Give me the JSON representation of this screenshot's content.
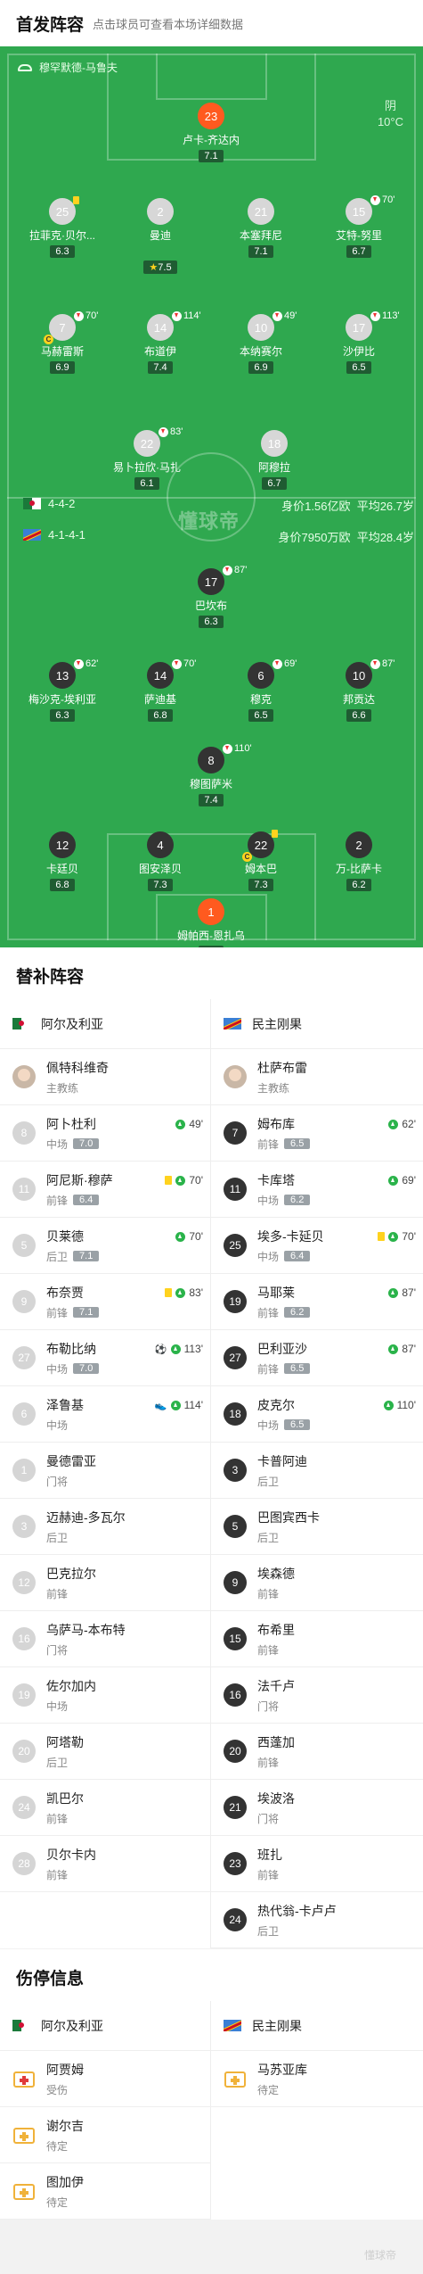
{
  "header": {
    "title": "首发阵容",
    "subtitle": "点击球员可查看本场详细数据"
  },
  "venue": "穆罕默德-马鲁夫",
  "weather": {
    "condition": "阴",
    "temp": "10°C"
  },
  "watermark": "懂球帝",
  "home": {
    "name": "阿尔及利亚",
    "formation": "4-4-2",
    "value": "身价1.56亿欧",
    "age": "平均26.7岁"
  },
  "away": {
    "name": "民主刚果",
    "formation": "4-1-4-1",
    "value": "身价7950万欧",
    "age": "平均28.4岁"
  },
  "home_players": [
    {
      "num": "23",
      "name": "卢卡-齐达内",
      "rating": "7.1"
    },
    {
      "num": "25",
      "name": "拉菲克·贝尔...",
      "rating": "6.3"
    },
    {
      "num": "2",
      "name": "曼迪",
      "rating": "7.5"
    },
    {
      "num": "21",
      "name": "本塞拜尼",
      "rating": "7.1"
    },
    {
      "num": "15",
      "name": "艾特-努里",
      "rating": "6.7",
      "sub": "70'"
    },
    {
      "num": "7",
      "name": "马赫雷斯",
      "rating": "6.9",
      "sub": "70'"
    },
    {
      "num": "14",
      "name": "布道伊",
      "rating": "7.4",
      "sub": "114'"
    },
    {
      "num": "10",
      "name": "本纳赛尔",
      "rating": "6.9",
      "sub": "49'"
    },
    {
      "num": "17",
      "name": "沙伊比",
      "rating": "6.5",
      "sub": "113'"
    },
    {
      "num": "22",
      "name": "易卜拉欣·马扎",
      "rating": "6.1",
      "sub": "83'"
    },
    {
      "num": "18",
      "name": "阿穆拉",
      "rating": "6.7"
    }
  ],
  "away_players": [
    {
      "num": "17",
      "name": "巴坎布",
      "rating": "6.3",
      "sub": "87'"
    },
    {
      "num": "13",
      "name": "梅沙克-埃利亚",
      "rating": "6.3",
      "sub": "62'"
    },
    {
      "num": "14",
      "name": "萨迪基",
      "rating": "6.8",
      "sub": "70'"
    },
    {
      "num": "6",
      "name": "穆克",
      "rating": "6.5",
      "sub": "69'"
    },
    {
      "num": "10",
      "name": "邦贡达",
      "rating": "6.6",
      "sub": "87'"
    },
    {
      "num": "8",
      "name": "穆图萨米",
      "rating": "7.4",
      "sub": "110'"
    },
    {
      "num": "12",
      "name": "卡廷贝",
      "rating": "6.8"
    },
    {
      "num": "4",
      "name": "图安泽贝",
      "rating": "7.3"
    },
    {
      "num": "22",
      "name": "姆本巴",
      "rating": "7.3"
    },
    {
      "num": "2",
      "name": "万-比萨卡",
      "rating": "6.2"
    },
    {
      "num": "1",
      "name": "姆帕西-恩扎乌",
      "rating": "6.8"
    }
  ],
  "subs_title": "替补阵容",
  "coach_label": "主教练",
  "home_coach": "佩特科维奇",
  "away_coach": "杜萨布雷",
  "home_subs": [
    {
      "num": "8",
      "name": "阿卜杜利",
      "pos": "中场",
      "rating": "7.0",
      "ev": "49'"
    },
    {
      "num": "11",
      "name": "阿尼斯·穆萨",
      "pos": "前锋",
      "rating": "6.4",
      "ev": "70'",
      "yc": true
    },
    {
      "num": "5",
      "name": "贝莱德",
      "pos": "后卫",
      "rating": "7.1",
      "ev": "70'"
    },
    {
      "num": "9",
      "name": "布奈贾",
      "pos": "前锋",
      "rating": "7.1",
      "ev": "83'",
      "yc": true
    },
    {
      "num": "27",
      "name": "布勒比纳",
      "pos": "中场",
      "rating": "7.0",
      "ev": "113'",
      "ball": true
    },
    {
      "num": "6",
      "name": "泽鲁基",
      "pos": "中场",
      "rating": "",
      "ev": "114'",
      "boot": true
    },
    {
      "num": "1",
      "name": "曼德雷亚",
      "pos": "门将",
      "rating": "",
      "ev": ""
    },
    {
      "num": "3",
      "name": "迈赫迪-多瓦尔",
      "pos": "后卫",
      "rating": "",
      "ev": ""
    },
    {
      "num": "12",
      "name": "巴克拉尔",
      "pos": "前锋",
      "rating": "",
      "ev": ""
    },
    {
      "num": "16",
      "name": "乌萨马-本布特",
      "pos": "门将",
      "rating": "",
      "ev": ""
    },
    {
      "num": "19",
      "name": "佐尔加内",
      "pos": "中场",
      "rating": "",
      "ev": ""
    },
    {
      "num": "20",
      "name": "阿塔勒",
      "pos": "后卫",
      "rating": "",
      "ev": ""
    },
    {
      "num": "24",
      "name": "凯巴尔",
      "pos": "前锋",
      "rating": "",
      "ev": ""
    },
    {
      "num": "28",
      "name": "贝尔卡内",
      "pos": "前锋",
      "rating": "",
      "ev": ""
    }
  ],
  "away_subs": [
    {
      "num": "7",
      "name": "姆布库",
      "pos": "前锋",
      "rating": "6.5",
      "ev": "62'"
    },
    {
      "num": "11",
      "name": "卡库塔",
      "pos": "中场",
      "rating": "6.2",
      "ev": "69'"
    },
    {
      "num": "25",
      "name": "埃多-卡延贝",
      "pos": "中场",
      "rating": "6.4",
      "ev": "70'",
      "yc": true
    },
    {
      "num": "19",
      "name": "马耶莱",
      "pos": "前锋",
      "rating": "6.2",
      "ev": "87'"
    },
    {
      "num": "27",
      "name": "巴利亚沙",
      "pos": "前锋",
      "rating": "6.5",
      "ev": "87'"
    },
    {
      "num": "18",
      "name": "皮克尔",
      "pos": "中场",
      "rating": "6.5",
      "ev": "110'"
    },
    {
      "num": "3",
      "name": "卡普阿迪",
      "pos": "后卫",
      "rating": "",
      "ev": ""
    },
    {
      "num": "5",
      "name": "巴图宾西卡",
      "pos": "后卫",
      "rating": "",
      "ev": ""
    },
    {
      "num": "9",
      "name": "埃森德",
      "pos": "前锋",
      "rating": "",
      "ev": ""
    },
    {
      "num": "15",
      "name": "布希里",
      "pos": "前锋",
      "rating": "",
      "ev": ""
    },
    {
      "num": "16",
      "name": "法千卢",
      "pos": "门将",
      "rating": "",
      "ev": ""
    },
    {
      "num": "20",
      "name": "西蓬加",
      "pos": "前锋",
      "rating": "",
      "ev": ""
    },
    {
      "num": "21",
      "name": "埃波洛",
      "pos": "门将",
      "rating": "",
      "ev": ""
    },
    {
      "num": "23",
      "name": "班扎",
      "pos": "前锋",
      "rating": "",
      "ev": ""
    },
    {
      "num": "24",
      "name": "热代翁-卡卢卢",
      "pos": "后卫",
      "rating": "",
      "ev": ""
    }
  ],
  "injury_title": "伤停信息",
  "home_injury": [
    {
      "name": "阿贾姆",
      "status": "受伤",
      "type": "red"
    },
    {
      "name": "谢尔吉",
      "status": "待定",
      "type": "yellow"
    },
    {
      "name": "图加伊",
      "status": "待定",
      "type": "yellow"
    }
  ],
  "away_injury": [
    {
      "name": "马苏亚库",
      "status": "待定",
      "type": "yellow"
    }
  ],
  "footer_wm": "懂球帝"
}
